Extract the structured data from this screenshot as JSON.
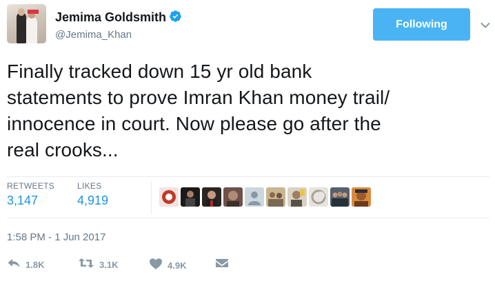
{
  "user": {
    "display_name": "Jemima Goldsmith",
    "handle": "@Jemima_Khan",
    "avatar": "profile-photo",
    "verified": true
  },
  "follow_button": {
    "label": "Following"
  },
  "menu": {
    "icon": "chevron-down-icon"
  },
  "tweet": {
    "text_lines": [
      "Finally tracked down 15 yr old bank",
      "statements to prove Imran Khan money trail/",
      "innocence in court. Now please go after the",
      "real crooks..."
    ]
  },
  "stats": {
    "retweets_label": "RETWEETS",
    "retweets_value": "3,147",
    "likes_label": "LIKES",
    "likes_value": "4,919"
  },
  "likers": [
    {
      "name": "liker-1",
      "color": "#c0392b"
    },
    {
      "name": "liker-2",
      "color": "#1a1a1a"
    },
    {
      "name": "liker-3",
      "color": "#3a2a26"
    },
    {
      "name": "liker-4",
      "color": "#8d6f63"
    },
    {
      "name": "liker-5",
      "color": "#d0d5da"
    },
    {
      "name": "liker-6",
      "color": "#b5a27a"
    },
    {
      "name": "liker-7",
      "color": "#b9b1a0"
    },
    {
      "name": "liker-8",
      "color": "#dcd8d2"
    },
    {
      "name": "liker-9",
      "color": "#3e4a56"
    },
    {
      "name": "liker-10",
      "color": "#c7692f"
    }
  ],
  "timestamp": "1:58 PM - 1 Jun 2017",
  "actions": {
    "reply_count": "1.8K",
    "retweet_count": "3.1K",
    "like_count": "4.9K"
  }
}
